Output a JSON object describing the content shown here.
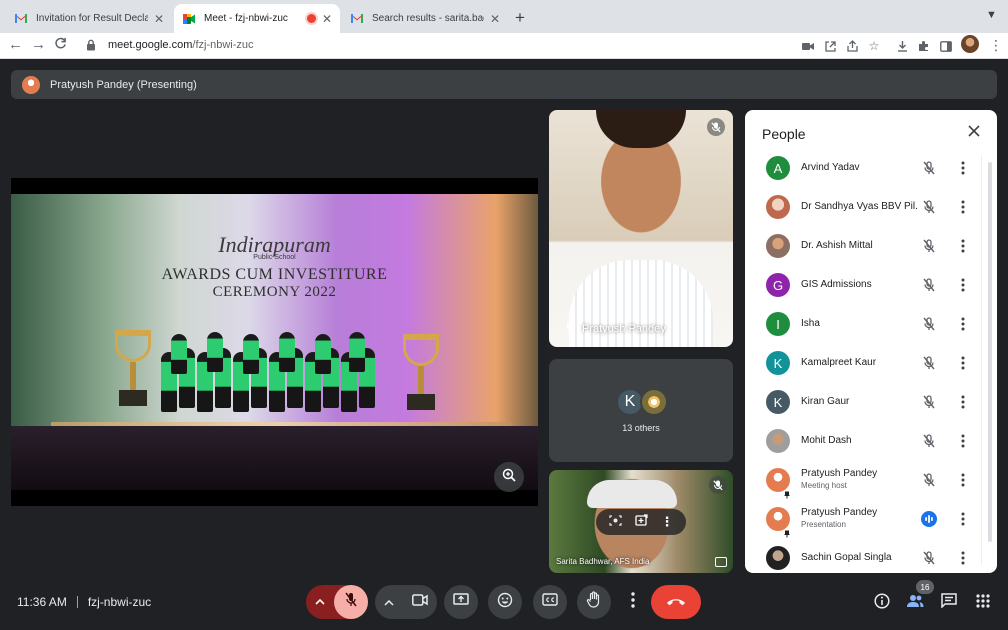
{
  "browser": {
    "tabs": [
      {
        "title": "Invitation for Result Declaration",
        "active": false
      },
      {
        "title": "Meet - fzj-nbwi-zuc",
        "active": true,
        "recording": true
      },
      {
        "title": "Search results - sarita.badhwa",
        "active": false
      }
    ],
    "url": {
      "host": "meet.google.com",
      "path": "/fzj-nbwi-zuc"
    }
  },
  "presenting": {
    "label": "Pratyush Pandey (Presenting)"
  },
  "slide": {
    "line1": "Indirapuram",
    "line2": "Public School",
    "line3": "AWARDS CUM INVESTITURE",
    "line4": "CEREMONY 2022"
  },
  "tiles": {
    "main_name": "Pratyush Pandey",
    "others_initial": "K",
    "others_count": "13 others",
    "bottom_name": "Sarita Badhwar, AFS India"
  },
  "people_panel": {
    "title": "People",
    "participants": [
      {
        "name": "Arvind Yadav",
        "initial": "A",
        "color": "#1e8e3e",
        "mic": "muted"
      },
      {
        "name": "Dr Sandhya Vyas BBV Pil...",
        "initial": "",
        "color": "#c0684e",
        "mic": "muted",
        "photo": true
      },
      {
        "name": "Dr. Ashish Mittal",
        "initial": "",
        "color": "#8d6e63",
        "mic": "muted",
        "photo": true
      },
      {
        "name": "GIS Admissions",
        "initial": "G",
        "color": "#8e24aa",
        "mic": "muted"
      },
      {
        "name": "Isha",
        "initial": "I",
        "color": "#1e8e3e",
        "mic": "muted"
      },
      {
        "name": "Kamalpreet Kaur",
        "initial": "K",
        "color": "#12939a",
        "mic": "muted"
      },
      {
        "name": "Kiran Gaur",
        "initial": "K",
        "color": "#455a64",
        "mic": "muted"
      },
      {
        "name": "Mohit Dash",
        "initial": "",
        "color": "#9e9e9e",
        "mic": "muted",
        "photo": true
      },
      {
        "name": "Pratyush Pandey",
        "sub": "Meeting host",
        "initial": "",
        "color": "#e57c4f",
        "mic": "muted",
        "photo": true
      },
      {
        "name": "Pratyush Pandey",
        "sub": "Presentation",
        "initial": "",
        "color": "#e57c4f",
        "mic": "speaking",
        "photo": true
      },
      {
        "name": "Sachin Gopal Singla",
        "initial": "",
        "color": "#212121",
        "mic": "muted",
        "photo": true
      }
    ]
  },
  "bottom_bar": {
    "time": "11:36 AM",
    "meeting_code": "fzj-nbwi-zuc",
    "people_count": "16"
  },
  "colors": {
    "end_call": "#ea4335",
    "mic_muted_bg": "#f6aea9",
    "speaking": "#1a73e8"
  }
}
